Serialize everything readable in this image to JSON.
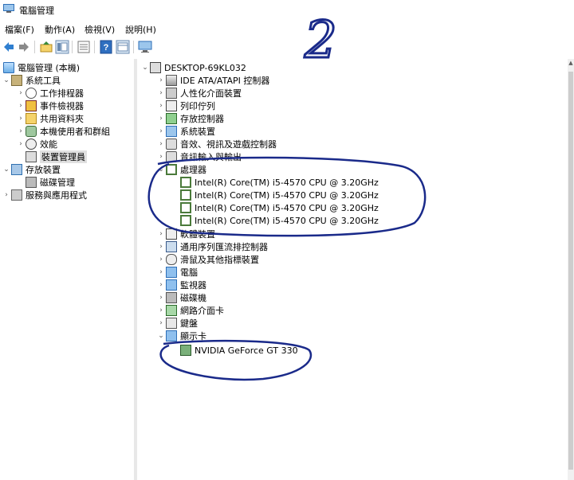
{
  "window": {
    "title": "電腦管理"
  },
  "menu": [
    "檔案(F)",
    "動作(A)",
    "檢視(V)",
    "說明(H)"
  ],
  "toolbar": {
    "buttons": [
      "back-icon",
      "forward-icon",
      "up-folder-icon",
      "show-hide-tree-icon",
      "properties-icon",
      "help-icon",
      "toggle-pane-icon",
      "monitor-icon"
    ]
  },
  "left_tree": [
    {
      "label": "電腦管理 (本機)",
      "icon": "computer-management-icon",
      "level": 0,
      "expander": ""
    },
    {
      "label": "系統工具",
      "icon": "system-tools-icon",
      "level": 1,
      "expander": "expanded"
    },
    {
      "label": "工作排程器",
      "icon": "task-scheduler-icon",
      "level": 2,
      "expander": "collapsed"
    },
    {
      "label": "事件檢視器",
      "icon": "event-viewer-icon",
      "level": 2,
      "expander": "collapsed"
    },
    {
      "label": "共用資料夾",
      "icon": "shared-folders-icon",
      "level": 2,
      "expander": "collapsed"
    },
    {
      "label": "本機使用者和群組",
      "icon": "local-users-icon",
      "level": 2,
      "expander": "collapsed"
    },
    {
      "label": "效能",
      "icon": "performance-icon",
      "level": 2,
      "expander": "collapsed"
    },
    {
      "label": "裝置管理員",
      "icon": "device-manager-icon",
      "level": 2,
      "expander": "",
      "selected": true
    },
    {
      "label": "存放裝置",
      "icon": "storage-icon",
      "level": 1,
      "expander": "expanded"
    },
    {
      "label": "磁碟管理",
      "icon": "disk-management-icon",
      "level": 2,
      "expander": ""
    },
    {
      "label": "服務與應用程式",
      "icon": "services-icon",
      "level": 1,
      "expander": "collapsed"
    }
  ],
  "device_tree": {
    "root": {
      "label": "DESKTOP-69KL032",
      "icon": "computer-icon"
    },
    "categories": [
      {
        "label": "IDE ATA/ATAPI 控制器",
        "icon": "ide-controller-icon",
        "expanded": false,
        "children": []
      },
      {
        "label": "人性化介面裝置",
        "icon": "hid-icon",
        "expanded": false,
        "children": []
      },
      {
        "label": "列印佇列",
        "icon": "printer-icon",
        "expanded": false,
        "children": []
      },
      {
        "label": "存放控制器",
        "icon": "storage-controller-icon",
        "expanded": false,
        "children": []
      },
      {
        "label": "系統裝置",
        "icon": "system-devices-icon",
        "expanded": false,
        "children": []
      },
      {
        "label": "音效、視訊及遊戲控制器",
        "icon": "sound-icon",
        "expanded": false,
        "children": []
      },
      {
        "label": "音訊輸入與輸出",
        "icon": "audio-io-icon",
        "expanded": false,
        "children": []
      },
      {
        "label": "處理器",
        "icon": "processor-icon",
        "expanded": true,
        "children": [
          "Intel(R) Core(TM) i5-4570 CPU @ 3.20GHz",
          "Intel(R) Core(TM) i5-4570 CPU @ 3.20GHz",
          "Intel(R) Core(TM) i5-4570 CPU @ 3.20GHz",
          "Intel(R) Core(TM) i5-4570 CPU @ 3.20GHz"
        ]
      },
      {
        "label": "軟體裝置",
        "icon": "software-device-icon",
        "expanded": false,
        "children": []
      },
      {
        "label": "通用序列匯流排控制器",
        "icon": "usb-icon",
        "expanded": false,
        "children": []
      },
      {
        "label": "滑鼠及其他指標裝置",
        "icon": "mouse-icon",
        "expanded": false,
        "children": []
      },
      {
        "label": "電腦",
        "icon": "pc-icon",
        "expanded": false,
        "children": []
      },
      {
        "label": "監視器",
        "icon": "monitor-icon",
        "expanded": false,
        "children": []
      },
      {
        "label": "磁碟機",
        "icon": "disk-drive-icon",
        "expanded": false,
        "children": []
      },
      {
        "label": "網路介面卡",
        "icon": "network-adapter-icon",
        "expanded": false,
        "children": []
      },
      {
        "label": "鍵盤",
        "icon": "keyboard-icon",
        "expanded": false,
        "children": []
      },
      {
        "label": "顯示卡",
        "icon": "display-adapter-icon",
        "expanded": true,
        "children": [
          "NVIDIA GeForce GT 330"
        ]
      }
    ]
  },
  "annotation": {
    "text": "2",
    "color": "#1a2a8a"
  }
}
